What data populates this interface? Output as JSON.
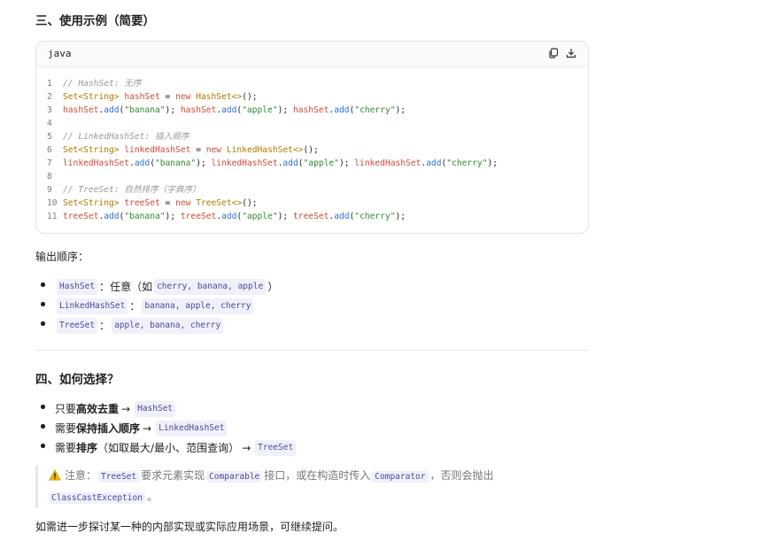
{
  "section3": {
    "title": "三、使用示例（简要）"
  },
  "code": {
    "lang": "java",
    "lines": [
      {
        "n": "1"
      },
      {
        "n": "2"
      },
      {
        "n": "3"
      },
      {
        "n": "4"
      },
      {
        "n": "5"
      },
      {
        "n": "6"
      },
      {
        "n": "7"
      },
      {
        "n": "8"
      },
      {
        "n": "9"
      },
      {
        "n": "10"
      },
      {
        "n": "11"
      }
    ],
    "comment1": "// HashSet: 无序",
    "comment2": "// LinkedHashSet: 插入顺序",
    "comment3": "// TreeSet: 自然排序（字典序）",
    "type_decl": "Set<String>",
    "var_hash": "hashSet",
    "var_linked": "linkedHashSet",
    "var_tree": "treeSet",
    "kw_new": "new",
    "ctor_hash": "HashSet<>",
    "ctor_linked": "LinkedHashSet<>",
    "ctor_tree": "TreeSet<>",
    "add": "add",
    "s_banana": "\"banana\"",
    "s_apple": "\"apple\"",
    "s_cherry": "\"cherry\""
  },
  "output": {
    "label": "输出顺序：",
    "items": [
      {
        "name": "HashSet",
        "sep": "：",
        "text": "任意（如",
        "value": "cherry, banana, apple",
        "close": "）"
      },
      {
        "name": "LinkedHashSet",
        "sep": "：",
        "value": "banana, apple, cherry"
      },
      {
        "name": "TreeSet",
        "sep": "：",
        "value": "apple, banana, cherry"
      }
    ]
  },
  "section4": {
    "title": "四、如何选择？",
    "items": [
      {
        "prefix": "只要",
        "bold": "高效去重",
        "arrow": "→",
        "code": "HashSet"
      },
      {
        "prefix": "需要",
        "bold": "保持插入顺序",
        "arrow": "→",
        "code": "LinkedHashSet"
      },
      {
        "prefix": "需要",
        "bold": "排序",
        "suffix": "（如取最大/最小、范围查询）",
        "arrow": "→",
        "code": "TreeSet"
      }
    ]
  },
  "note": {
    "label": "注意：",
    "c1": "TreeSet",
    "t1": "要求元素实现",
    "c2": "Comparable",
    "t2": "接口，或在构造时传入",
    "c3": "Comparator",
    "t3": "，否则会抛出",
    "c4": "ClassCastException",
    "t4": "。"
  },
  "tail": "如需进一步探讨某一种的内部实现或实际应用场景，可继续提问。",
  "colors": {
    "accent_code": "#4a4a9a",
    "code_bg": "#f0f0fb",
    "warning": "#f2b600"
  }
}
